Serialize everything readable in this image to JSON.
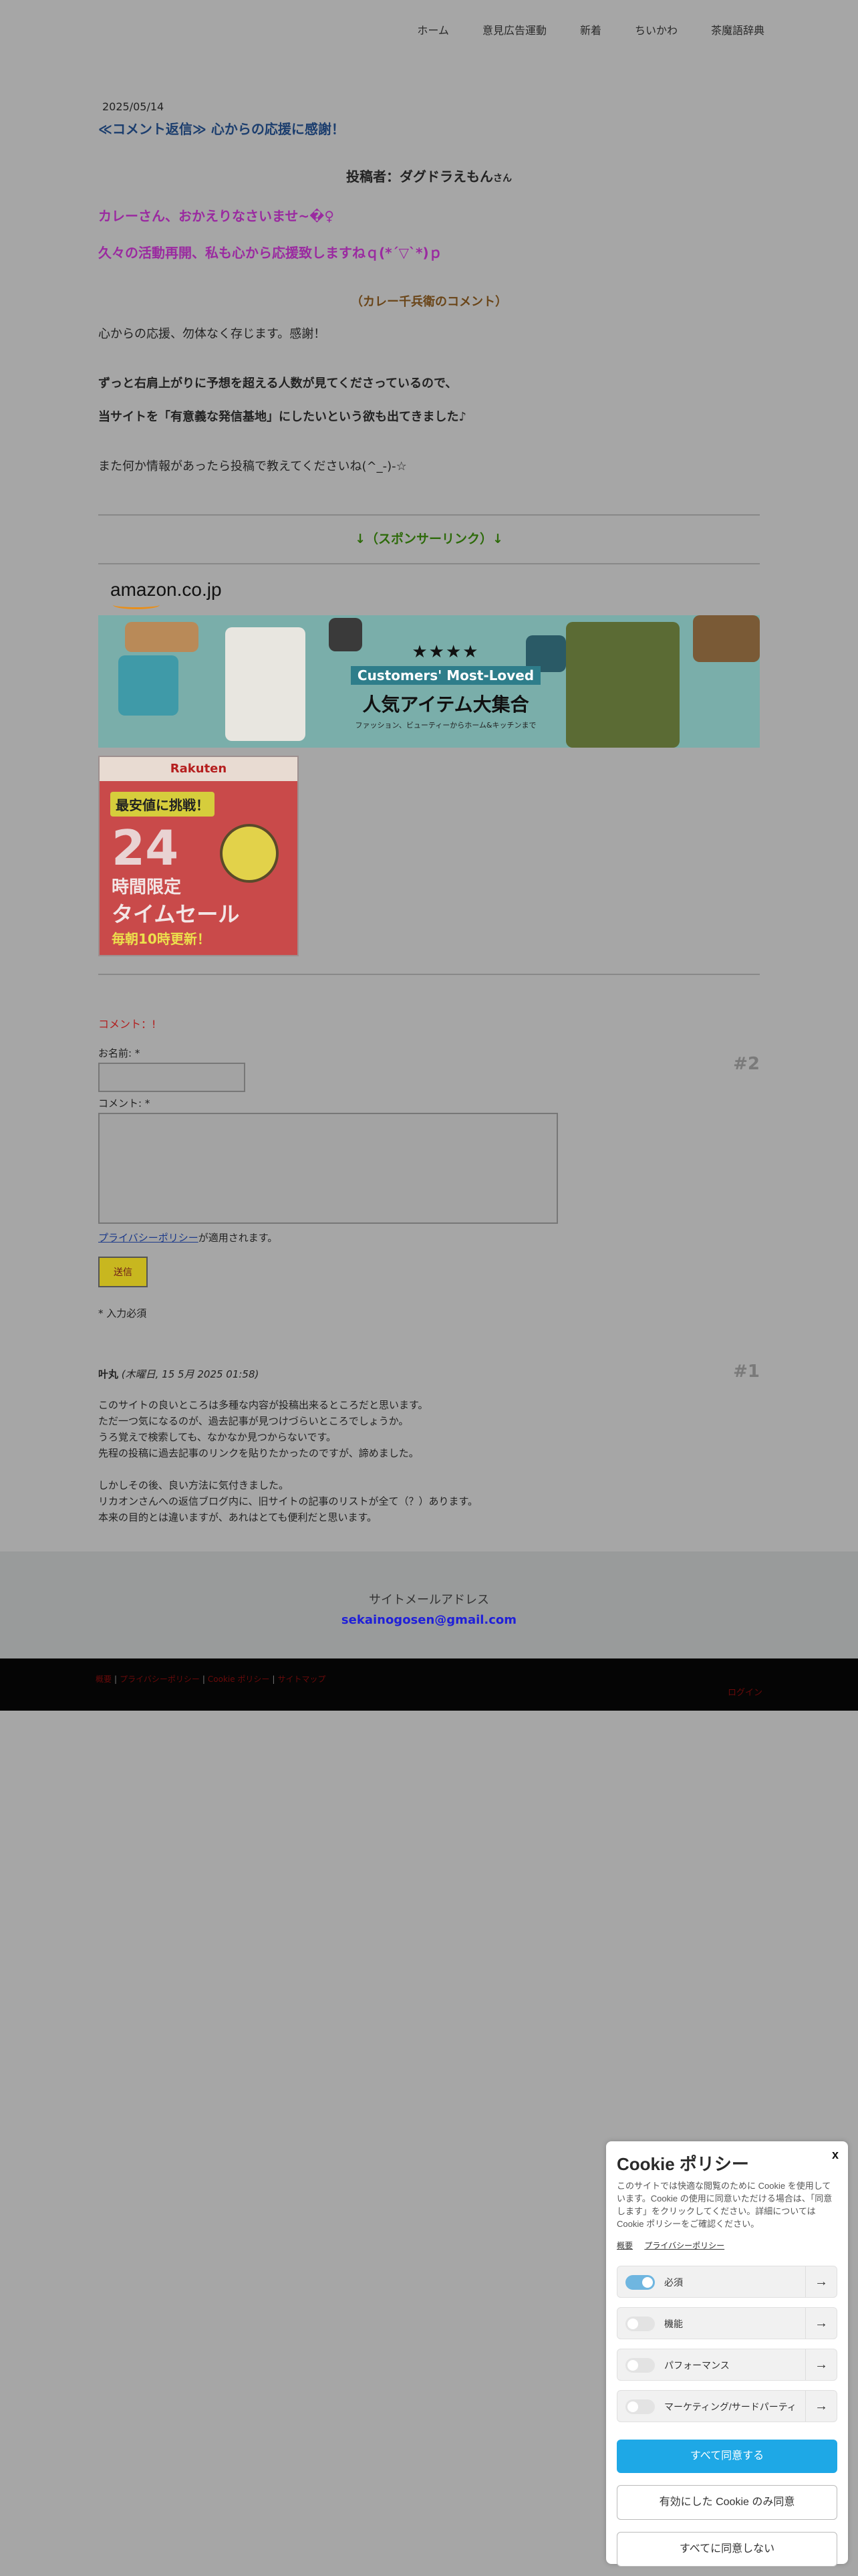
{
  "nav": {
    "items": [
      "ホーム",
      "意見広告運動",
      "新着",
      "ちいかわ",
      "茶魔語辞典"
    ]
  },
  "post": {
    "date": "2025/05/14",
    "title": "≪コメント返信≫ 心からの応援に感謝！",
    "author_label": "投稿者：ダグドラえもん",
    "author_suffix": "さん",
    "line1": "カレーさん、おかえりなさいませ~�♀",
    "line2": "久々の活動再開、私も心から応援致しますねｑ(*´▽`*)ｐ",
    "caption": "（カレー千兵衛のコメント）",
    "p1": "心からの応援、勿体なく存じます。感謝！",
    "p2": "ずっと右肩上がりに予想を超える人数が見てくださっているので、",
    "p3": "当サイトを「有意義な発信基地」にしたいという欲も出てきました♪",
    "p4": "また何か情報があったら投稿で教えてくださいね(^_-)-☆"
  },
  "sponsor": {
    "label": "↓（スポンサーリンク）↓",
    "amazon_logo": "amazon.co.jp",
    "amazon_banner": {
      "stars": "★★★★",
      "tag": "Customers' Most-Loved",
      "headline": "人気アイテム大集合",
      "sub": "ファッション、ビューティーからホーム&キッチンまで"
    },
    "rakuten": {
      "logo": "Rakuten",
      "challenge": "最安値に挑戦！",
      "hours": "24",
      "limited": "時間限定",
      "timesale": "タイムセール",
      "daily": "毎朝10時更新！"
    }
  },
  "form": {
    "title": "コメント：!",
    "number": "#2",
    "name_label": "お名前: *",
    "comment_label": "コメント: *",
    "privacy_link": "プライバシーポリシー",
    "privacy_text": "が適用されます。",
    "submit": "送信",
    "required_note": "* 入力必須"
  },
  "comment": {
    "number": "#1",
    "author": "叶丸",
    "date": "(木曜日, 15 5月 2025 01:58)",
    "lines_a": [
      "このサイトの良いところは多種な内容が投稿出来るところだと思います。",
      "ただ一つ気になるのが、過去記事が見つけづらいところでしょうか。",
      "うろ覚えで検索しても、なかなか見つからないです。",
      "先程の投稿に過去記事のリンクを貼りたかったのですが、諦めました。"
    ],
    "lines_b": [
      "しかしその後、良い方法に気付きました。",
      "リカオンさんへの返信ブログ内に、旧サイトの記事のリストが全て（？）あります。",
      "本来の目的とは違いますが、あれはとても便利だと思います。"
    ]
  },
  "footer": {
    "label": "サイトメールアドレス",
    "email": "sekainogosen@gmail.com"
  },
  "bottom_bar": {
    "links": [
      "概要",
      "プライバシーポリシー",
      "Cookie ポリシー",
      "サイトマップ"
    ],
    "login": "ログイン"
  },
  "cookie": {
    "close": "x",
    "title": "Cookie ポリシー",
    "description": "このサイトでは快適な閲覧のために Cookie を使用しています。Cookie の使用に同意いただける場合は、「同意します」をクリックしてください。詳細については Cookie ポリシーをご確認ください。",
    "links": [
      "概要",
      "プライバシーポリシー"
    ],
    "rows": [
      {
        "label": "必須",
        "on": true
      },
      {
        "label": "機能",
        "on": false
      },
      {
        "label": "パフォーマンス",
        "on": false
      },
      {
        "label": "マーケティング/サードパーティ",
        "on": false
      }
    ],
    "accept_all": "すべて同意する",
    "accept_selected": "有効にした Cookie のみ同意",
    "reject_all": "すべてに同意しない"
  },
  "colors": {
    "page_bg": "#a6a6a6",
    "accent_blue": "#1ea8e6",
    "title_blue": "#1c3e6e",
    "pink": "#9a2aa0"
  }
}
